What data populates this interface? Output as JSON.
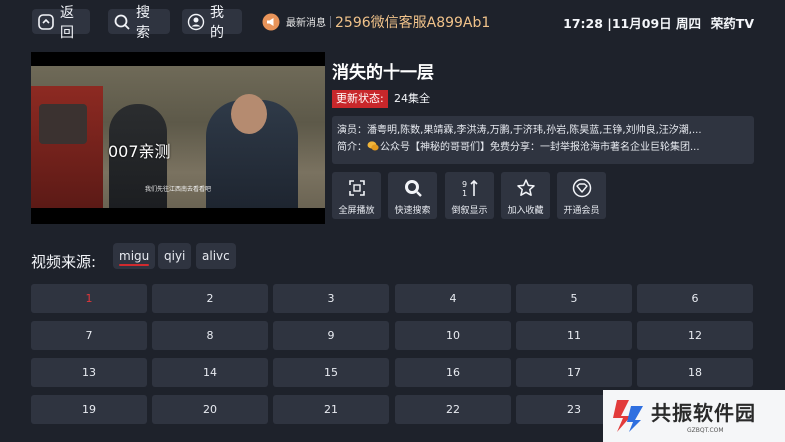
{
  "nav": {
    "back": "返回",
    "search": "搜索",
    "mine": "我的"
  },
  "notice": {
    "label": "最新消息",
    "text": "2596微信客服A899Ab1"
  },
  "clock": "17:28 |11月09日 周四",
  "brand": "荣药TV",
  "player": {
    "watermark": "007亲测",
    "subtitle": "我们先往江西南去看看吧"
  },
  "show": {
    "title": "消失的十一层",
    "status_label": "更新状态:",
    "status_value": "24集全",
    "cast": "演员：潘粤明,陈数,果靖霖,李洪涛,万鹏,于济玮,孙岩,陈昊蓝,王铮,刘帅良,汪汐潮,...",
    "intro_prefix": "简介：",
    "intro": "公众号【神秘的哥哥们】免费分享：一封举报沧海市著名企业巨轮集团..."
  },
  "actions": [
    {
      "label": "全屏播放",
      "icon": "fullscreen-icon"
    },
    {
      "label": "快速搜索",
      "icon": "search-icon"
    },
    {
      "label": "倒叙显示",
      "icon": "sort-icon"
    },
    {
      "label": "加入收藏",
      "icon": "star-icon"
    },
    {
      "label": "开通会员",
      "icon": "vip-icon"
    }
  ],
  "sources": {
    "title": "视频来源:",
    "tabs": [
      "migu",
      "qiyi",
      "alivc"
    ],
    "selected": "migu"
  },
  "episodes": [
    "1",
    "2",
    "3",
    "4",
    "5",
    "6",
    "7",
    "8",
    "9",
    "10",
    "11",
    "12",
    "13",
    "14",
    "15",
    "16",
    "17",
    "18",
    "19",
    "20",
    "21",
    "22",
    "23"
  ],
  "current_episode": "1",
  "logo": {
    "text": "共振软件园",
    "sub": "GZBQT.COM"
  },
  "colors": {
    "background": "#1e222b",
    "panel": "#2f3440",
    "accent_red": "#c8272b",
    "notice": "#f0c28a"
  }
}
